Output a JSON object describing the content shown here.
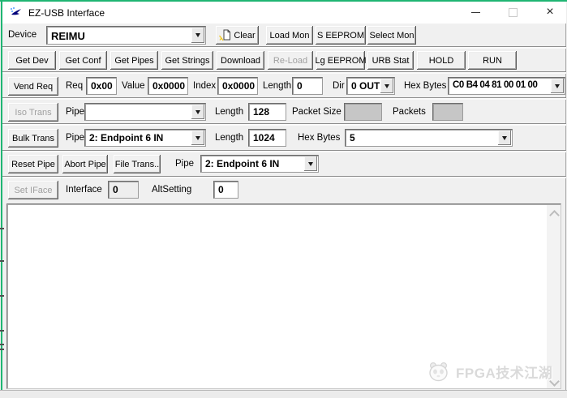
{
  "window": {
    "title": "EZ-USB Interface"
  },
  "colors": {
    "accent_green": "#1fb573",
    "dialog_bg": "#f0f0f0",
    "disabled_text": "#a0a0a0",
    "disabled_field_bg": "#c6c6c6"
  },
  "device_row": {
    "label": "Device",
    "device_value": "REIMU",
    "clear_button": "Clear",
    "load_mon_button": "Load Mon",
    "s_eeprom_button": "S EEPROM",
    "select_mon_button": "Select Mon"
  },
  "action_row": {
    "buttons": [
      "Get Dev",
      "Get Conf",
      "Get Pipes",
      "Get Strings",
      "Download",
      "Re-Load",
      "Lg EEPROM",
      "URB Stat",
      "HOLD",
      "RUN"
    ],
    "disabled_buttons": [
      "Re-Load"
    ]
  },
  "vend_req_row": {
    "button": "Vend Req",
    "req_label": "Req",
    "req_value": "0x00",
    "value_label": "Value",
    "value_value": "0x0000",
    "index_label": "Index",
    "index_value": "0x0000",
    "length_label": "Length",
    "length_value": "0",
    "dir_label": "Dir",
    "dir_value": "0 OUT",
    "hex_bytes_label": "Hex Bytes",
    "hex_bytes_value": "C0 B4 04 81 00 01 00"
  },
  "iso_trans_row": {
    "button": "Iso Trans",
    "pipe_label": "Pipe",
    "pipe_value": "",
    "length_label": "Length",
    "length_value": "128",
    "packet_size_label": "Packet Size",
    "packet_size_value": "",
    "packets_label": "Packets",
    "packets_value": ""
  },
  "bulk_trans_row": {
    "button": "Bulk Trans",
    "pipe_label": "Pipe",
    "pipe_value": "2: Endpoint 6 IN",
    "length_label": "Length",
    "length_value": "1024",
    "hex_bytes_label": "Hex Bytes",
    "hex_bytes_value": "5"
  },
  "pipe_row": {
    "reset_button": "Reset Pipe",
    "abort_button": "Abort Pipe",
    "file_trans_button": "File Trans..",
    "pipe_label": "Pipe",
    "pipe_value": "2: Endpoint 6 IN"
  },
  "iface_row": {
    "button": "Set IFace",
    "interface_label": "Interface",
    "interface_value": "0",
    "altsetting_label": "AltSetting",
    "altsetting_value": "0"
  },
  "output_area": {
    "content": ""
  },
  "watermark": {
    "text": "FPGA技术江湖"
  }
}
